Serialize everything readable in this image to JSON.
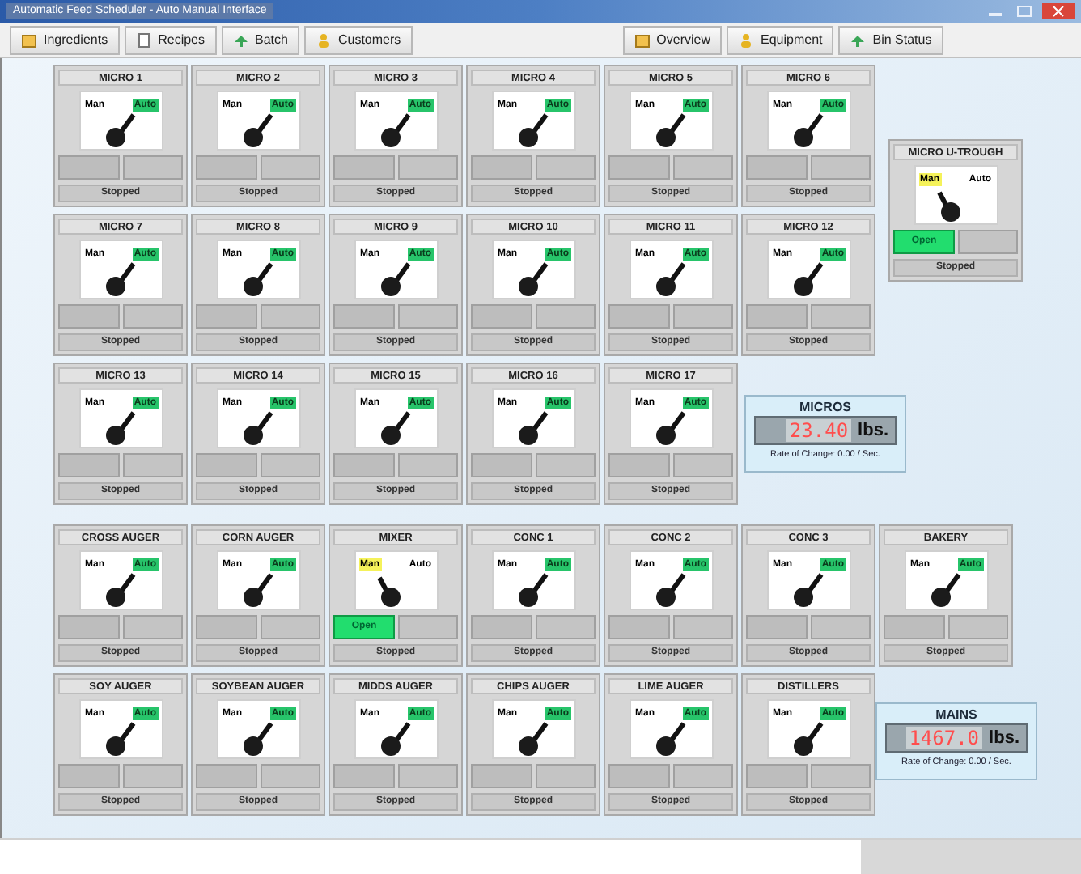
{
  "window": {
    "title": "Automatic Feed Scheduler - Auto Manual Interface"
  },
  "toolbar_left": [
    {
      "label": "Ingredients"
    },
    {
      "label": "Recipes"
    },
    {
      "label": "Batch"
    },
    {
      "label": "Customers"
    }
  ],
  "toolbar_right": [
    {
      "label": "Overview"
    },
    {
      "label": "Equipment"
    },
    {
      "label": "Bin Status"
    }
  ],
  "micro_units": [
    {
      "name": "MICRO 1",
      "auto": true,
      "man_label": "Man",
      "auto_label": "Auto",
      "status": "Stopped"
    },
    {
      "name": "MICRO 2",
      "auto": true,
      "man_label": "Man",
      "auto_label": "Auto",
      "status": "Stopped"
    },
    {
      "name": "MICRO 3",
      "auto": true,
      "man_label": "Man",
      "auto_label": "Auto",
      "status": "Stopped"
    },
    {
      "name": "MICRO 4",
      "auto": true,
      "man_label": "Man",
      "auto_label": "Auto",
      "status": "Stopped"
    },
    {
      "name": "MICRO 5",
      "auto": true,
      "man_label": "Man",
      "auto_label": "Auto",
      "status": "Stopped"
    },
    {
      "name": "MICRO 6",
      "auto": true,
      "man_label": "Man",
      "auto_label": "Auto",
      "status": "Stopped"
    },
    {
      "name": "MICRO 7",
      "auto": true,
      "man_label": "Man",
      "auto_label": "Auto",
      "status": "Stopped"
    },
    {
      "name": "MICRO 8",
      "auto": true,
      "man_label": "Man",
      "auto_label": "Auto",
      "status": "Stopped"
    },
    {
      "name": "MICRO 9",
      "auto": true,
      "man_label": "Man",
      "auto_label": "Auto",
      "status": "Stopped"
    },
    {
      "name": "MICRO 10",
      "auto": true,
      "man_label": "Man",
      "auto_label": "Auto",
      "status": "Stopped"
    },
    {
      "name": "MICRO 11",
      "auto": true,
      "man_label": "Man",
      "auto_label": "Auto",
      "status": "Stopped"
    },
    {
      "name": "MICRO 12",
      "auto": true,
      "man_label": "Man",
      "auto_label": "Auto",
      "status": "Stopped"
    },
    {
      "name": "MICRO 13",
      "auto": true,
      "man_label": "Man",
      "auto_label": "Auto",
      "status": "Stopped"
    },
    {
      "name": "MICRO 14",
      "auto": true,
      "man_label": "Man",
      "auto_label": "Auto",
      "status": "Stopped"
    },
    {
      "name": "MICRO 15",
      "auto": true,
      "man_label": "Man",
      "auto_label": "Auto",
      "status": "Stopped"
    },
    {
      "name": "MICRO 16",
      "auto": true,
      "man_label": "Man",
      "auto_label": "Auto",
      "status": "Stopped"
    },
    {
      "name": "MICRO 17",
      "auto": true,
      "man_label": "Man",
      "auto_label": "Auto",
      "status": "Stopped"
    }
  ],
  "micro_trough": {
    "name": "MICRO U-TROUGH",
    "auto": false,
    "man_label": "Man",
    "auto_label": "Auto",
    "button": "Open",
    "status": "Stopped"
  },
  "micros_scale": {
    "title": "MICROS",
    "value": "23.40",
    "unit": "lbs.",
    "rate": "Rate of Change: 0.00 / Sec."
  },
  "main_units": [
    {
      "name": "CROSS AUGER",
      "auto": true,
      "man_label": "Man",
      "auto_label": "Auto",
      "status": "Stopped"
    },
    {
      "name": "CORN AUGER",
      "auto": true,
      "man_label": "Man",
      "auto_label": "Auto",
      "status": "Stopped"
    },
    {
      "name": "MIXER",
      "auto": false,
      "man_label": "Man",
      "auto_label": "Auto",
      "button": "Open",
      "status": "Stopped"
    },
    {
      "name": "CONC 1",
      "auto": true,
      "man_label": "Man",
      "auto_label": "Auto",
      "status": "Stopped"
    },
    {
      "name": "CONC 2",
      "auto": true,
      "man_label": "Man",
      "auto_label": "Auto",
      "status": "Stopped"
    },
    {
      "name": "CONC 3",
      "auto": true,
      "man_label": "Man",
      "auto_label": "Auto",
      "status": "Stopped"
    },
    {
      "name": "BAKERY",
      "auto": true,
      "man_label": "Man",
      "auto_label": "Auto",
      "status": "Stopped"
    },
    {
      "name": "SOY AUGER",
      "auto": true,
      "man_label": "Man",
      "auto_label": "Auto",
      "status": "Stopped"
    },
    {
      "name": "SOYBEAN AUGER",
      "auto": true,
      "man_label": "Man",
      "auto_label": "Auto",
      "status": "Stopped"
    },
    {
      "name": "MIDDS AUGER",
      "auto": true,
      "man_label": "Man",
      "auto_label": "Auto",
      "status": "Stopped"
    },
    {
      "name": "CHIPS AUGER",
      "auto": true,
      "man_label": "Man",
      "auto_label": "Auto",
      "status": "Stopped"
    },
    {
      "name": "LIME AUGER",
      "auto": true,
      "man_label": "Man",
      "auto_label": "Auto",
      "status": "Stopped"
    },
    {
      "name": "DISTILLERS",
      "auto": true,
      "man_label": "Man",
      "auto_label": "Auto",
      "status": "Stopped"
    }
  ],
  "mains_scale": {
    "title": "MAINS",
    "value": "1467.0",
    "unit": "lbs.",
    "rate": "Rate of Change: 0.00 / Sec."
  }
}
